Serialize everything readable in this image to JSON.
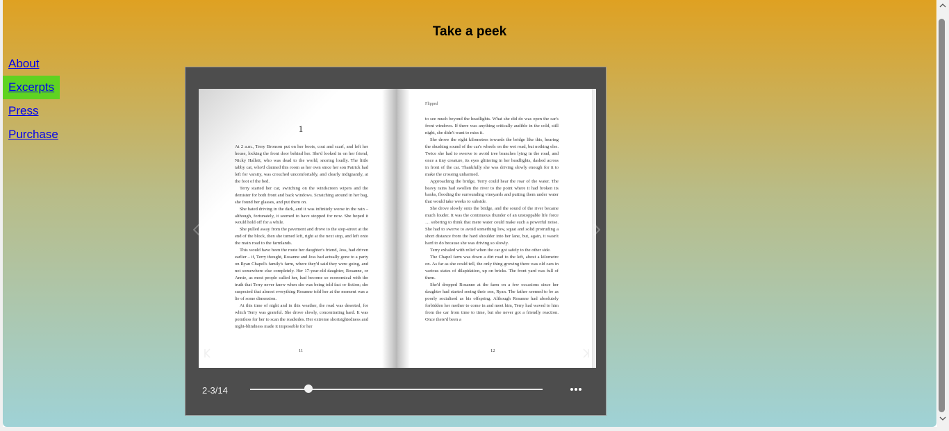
{
  "header": {
    "title": "Take a peek"
  },
  "nav": {
    "items": [
      {
        "label": "About",
        "active": false
      },
      {
        "label": "Excerpts",
        "active": true
      },
      {
        "label": "Press",
        "active": false
      },
      {
        "label": "Purchase",
        "active": false
      }
    ]
  },
  "book": {
    "left_page": {
      "chapter_number": "1",
      "paragraphs": [
        "At 2 a.m., Terry Bronson put on her boots, coat and scarf, and left her house, locking the front door behind her. She'd looked in on her friend, Nicky Hallett, who was dead to the world, snoring loudly. The little tabby cat, who'd claimed this room as her own since her son Patrick had left for varsity, was crouched uncomfortably, and clearly indignantly, at the foot of the bed.",
        "Terry started her car, switching on the windscreen wipers and the demister for both front and back windows. Scratching around in her bag, she found her glasses, and put them on.",
        "She hated driving in the dark, and it was infinitely worse in the rain – although, fortunately, it seemed to have stopped for now. She hoped it would hold off for a while.",
        "She pulled away from the pavement and drove to the stop-street at the end of the block, then she turned left, right at the next stop, and left onto the main road to the farmlands.",
        "This would have been the route her daughter's friend, Jess, had driven earlier – if, Terry thought, Rosanne and Jess had actually gone to a party on Ryan Chapel's family's farm, where they'd said they were going, and not somewhere else completely. Her 17-year-old daughter, Rosanne, or Annie, as most people called her, had become so economical with the truth that Terry never knew when she was being told fact or fiction; she suspected that almost everything Rosanne told her at the moment was a lie of some dimension.",
        "At this time of night and in this weather, the road was deserted, for which Terry was grateful. She drove slowly, concentrating hard. It was pointless for her to scan the roadsides. Her extreme shortsightedness and night-blindness made it impossible for her"
      ],
      "folio": "11"
    },
    "right_page": {
      "running_head": "Flipped",
      "paragraphs": [
        "to see much beyond the headlights. What she did do was open the car's front windows. If there was anything critically audible in the cold, still night, she didn't want to miss it.",
        "She drove the eight kilometres towards the bridge like this, hearing the shushing sound of the car's wheels on the wet road, but nothing else. Twice she had to swerve to avoid tree branches lying in the road, and once a tiny creature, its eyes glittering in her headlights, dashed across in front of the car. Thankfully she was driving slowly enough for it to make the crossing unharmed.",
        "Approaching the bridge, Terry could hear the roar of the water. The heavy rains had swollen the river to the point where it had broken its banks, flooding the surrounding vineyards and putting them under water that would take weeks to subside.",
        "She drove slowly onto the bridge, and the sound of the river became much louder. It was the continuous thunder of an unstoppable life force … sobering to think that mere water could make such a powerful noise. She had to swerve to avoid something low, squat and solid protruding a short distance from the hard shoulder into her lane, but, again, it wasn't hard to do because she was driving so slowly.",
        "Terry exhaled with relief when the car got safely to the other side.",
        "The Chapel farm was down a dirt road to the left, about a kilometre on. As far as she could tell, the only thing growing there was old cars in various states of dilapidation, up on bricks. The front yard was full of them.",
        "She'd dropped Rosanne at the farm on a few occasions since her daughter had started seeing their son, Ryan. The father seemed to be as poorly socialised as his offspring. Although Rosanne had absolutely forbidden her mother to come in and meet him, Terry had waved to him from the car from time to time, but she never got a friendly reaction. Once there'd been a"
      ],
      "folio": "12"
    },
    "controls": {
      "page_counter": "2-3/14",
      "progress": 0.2,
      "more_icon": "ellipsis-icon",
      "prev_icon": "chevron-left-icon",
      "next_icon": "chevron-right-icon"
    }
  },
  "colors": {
    "gradient_top": "#dfa122",
    "gradient_bottom": "#9fd2d6",
    "active_nav_bg": "#5fd321",
    "link": "#0000ee",
    "viewer_bg": "#4d4d4d"
  }
}
